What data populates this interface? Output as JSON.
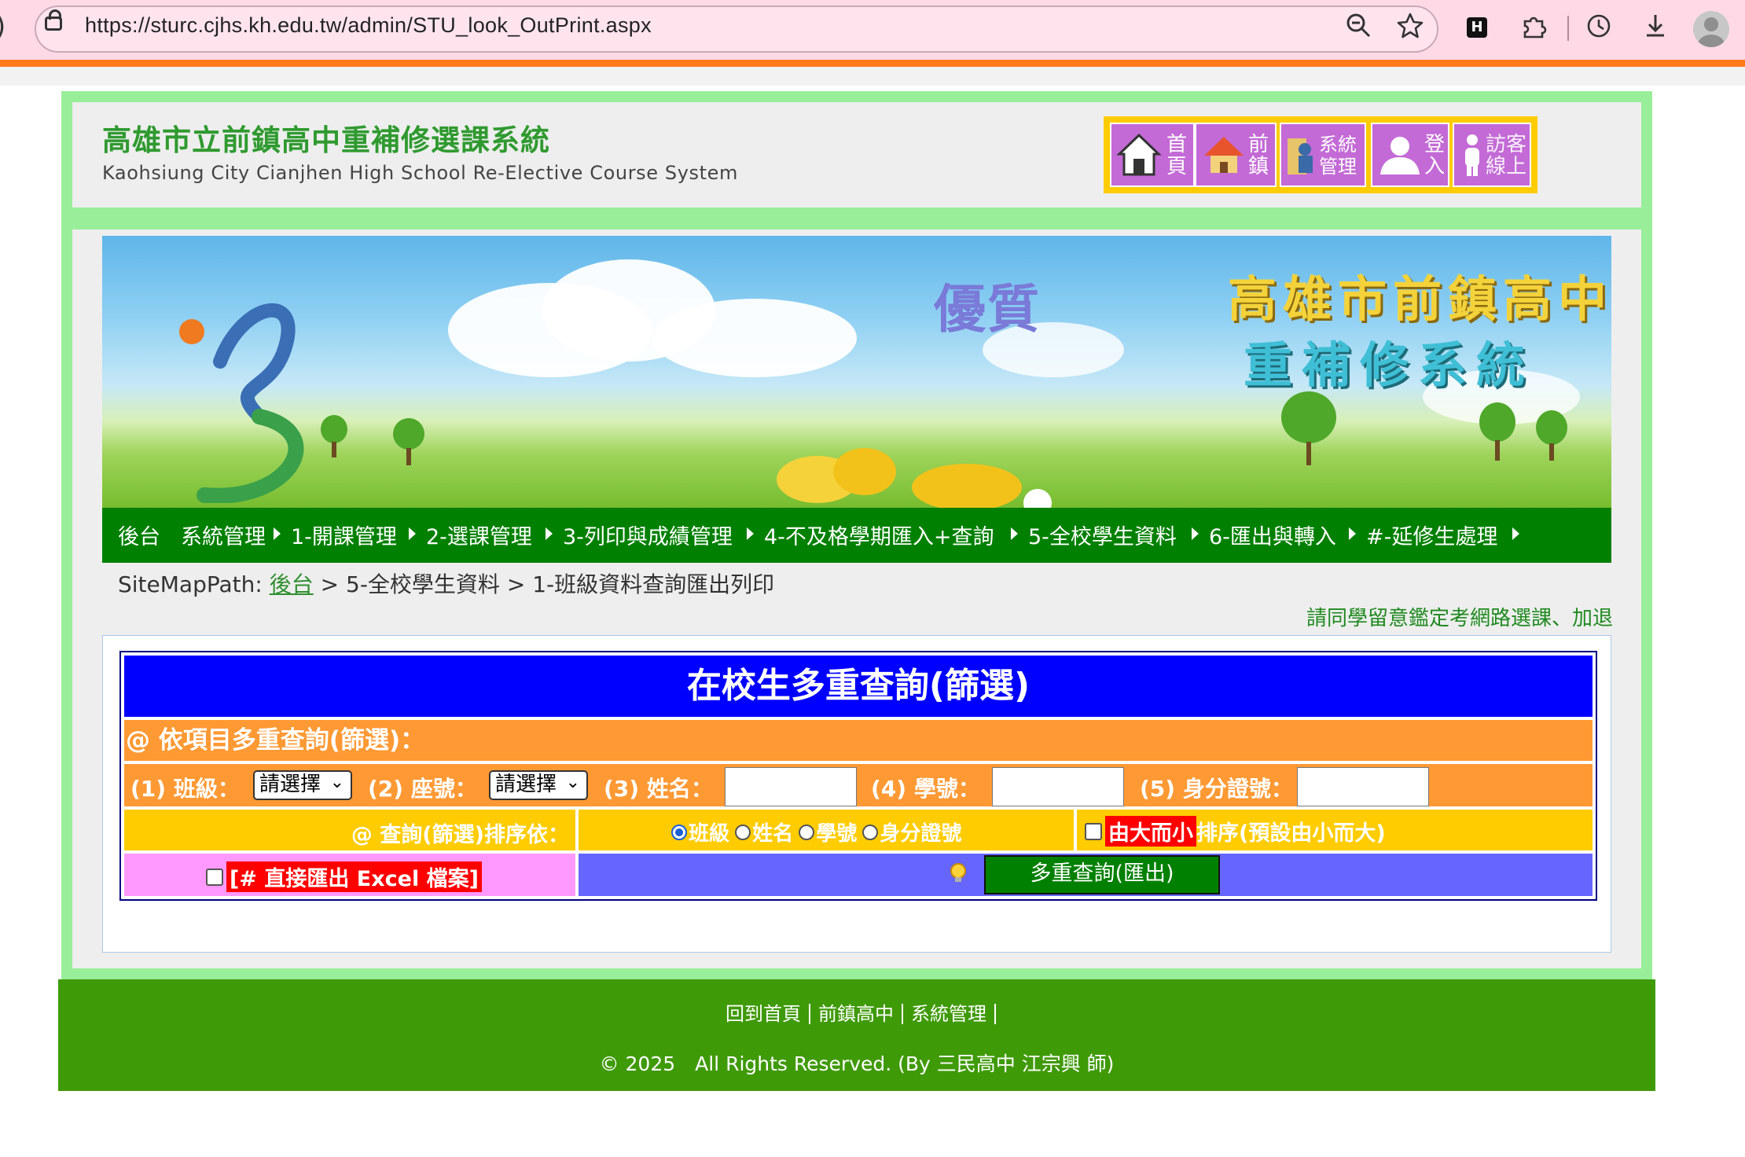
{
  "browser": {
    "url": "https://sturc.cjhs.kh.edu.tw/admin/STU_look_OutPrint.aspx",
    "icons": [
      "lock-icon",
      "zoom-out-icon",
      "star-icon",
      "extension-h-icon",
      "puzzle-icon",
      "history-icon",
      "download-icon",
      "profile-avatar"
    ]
  },
  "header": {
    "title": "高雄市立前鎮高中重補修選課系統",
    "subtitle": "Kaohsiung City Cianjhen High School Re-Elective Course System",
    "nav": [
      {
        "label": "首\n頁",
        "icon": "home-icon"
      },
      {
        "label": "前\n鎮",
        "icon": "house-icon"
      },
      {
        "label": "系統\n管理",
        "icon": "admin-icon"
      },
      {
        "label": "登\n入",
        "icon": "user-icon"
      },
      {
        "label": "訪客\n線上",
        "icon": "visitor-icon"
      }
    ]
  },
  "banner": {
    "word": "優質",
    "line1": "高雄市前鎮高中",
    "line2": "重補修系統"
  },
  "menu": {
    "items": [
      "後台",
      "系統管理",
      "1-開課管理",
      "2-選課管理",
      "3-列印與成績管理",
      "4-不及格學期匯入+查詢",
      "5-全校學生資料",
      "6-匯出與轉入",
      "#-延修生處理"
    ]
  },
  "sitemap": {
    "prefix": "SiteMapPath:",
    "link": "後台",
    "sep1": ">",
    "crumb2": "5-全校學生資料",
    "sep2": ">",
    "crumb3": "1-班級資料查詢匯出列印"
  },
  "notice": "請同學留意鑑定考網路選課、加退",
  "query": {
    "title": "在校生多重查詢(篩選)",
    "subtitle": "@ 依項目多重查詢(篩選)：",
    "fields": {
      "class_label": "(1) 班級：",
      "class_value": "請選擇",
      "seat_label": "(2) 座號：",
      "seat_value": "請選擇",
      "name_label": "(3) 姓名：",
      "studentno_label": "(4) 學號：",
      "idno_label": "(5) 身分證號："
    },
    "sort_label": "@ 查詢(篩選)排序依：",
    "sort_options": [
      "班級",
      "姓名",
      "學號",
      "身分證號"
    ],
    "sort_selected": "班級",
    "desc_label": "由大而小",
    "desc_note": "排序(預設由小而大)",
    "excel_label": "[# 直接匯出 Excel 檔案]",
    "submit_label": "多重查詢(匯出)"
  },
  "footer": {
    "links": [
      "回到首頁",
      "前鎮高中",
      "系統管理"
    ],
    "copyright": "© 2025　All Rights Reserved. (By 三民高中 江宗興 師)"
  },
  "colors": {
    "title_green": "#2f9a2f",
    "frame_green": "#99ee99",
    "menu_green": "#008000",
    "query_blue": "#0000ff",
    "query_orange": "#ff9933",
    "query_yellow": "#ffcc00",
    "query_pink": "#ff99ff",
    "query_violet": "#6666ff",
    "footer_green": "#3f9a08"
  }
}
